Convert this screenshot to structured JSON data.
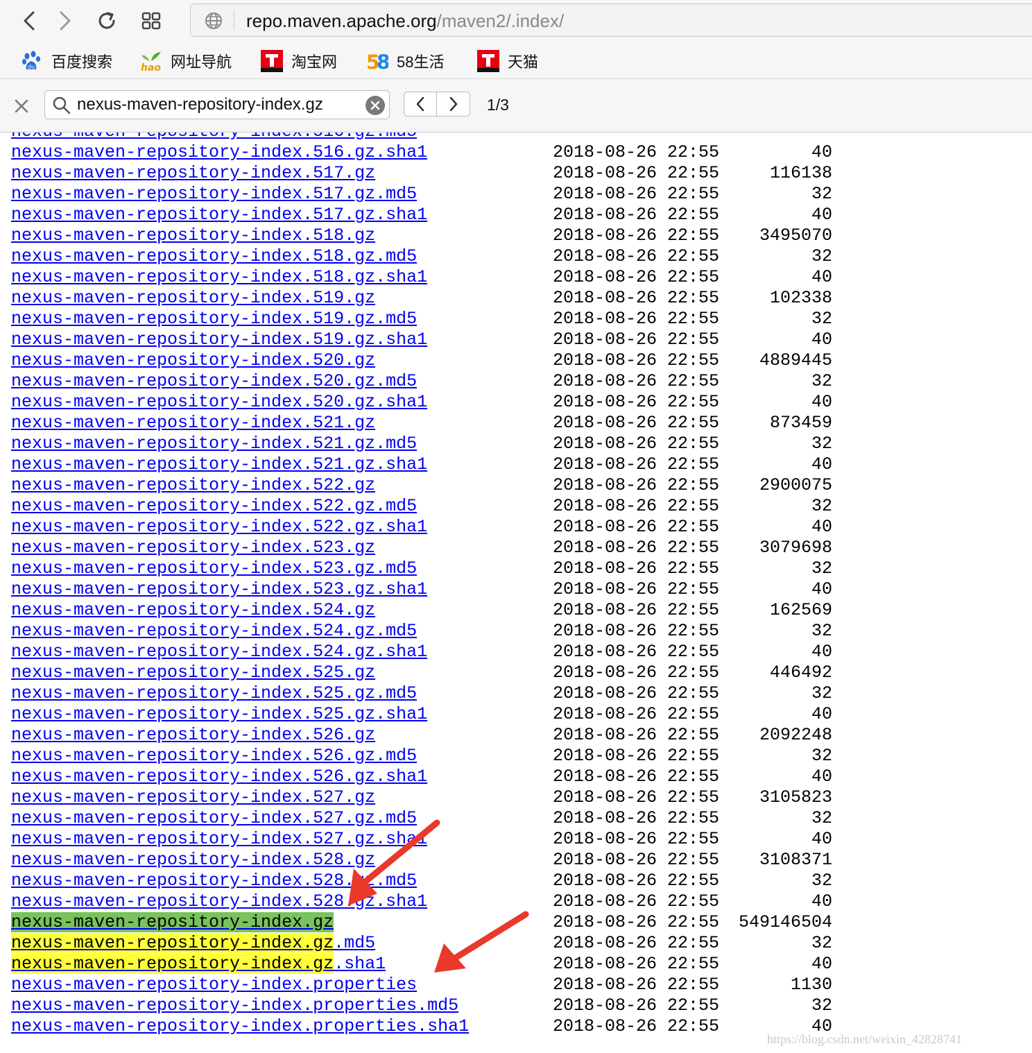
{
  "browser": {
    "url_host": "repo.maven.apache.org",
    "url_path": "/maven2/.index/",
    "icons": {
      "back": "chevron-left-icon",
      "forward": "chevron-right-icon",
      "reload": "reload-icon",
      "tabs": "grid-icon",
      "site": "globe-icon"
    }
  },
  "bookmarks": [
    {
      "label": "百度搜索",
      "icon": "baidu-paw-icon"
    },
    {
      "label": "网址导航",
      "icon": "hao-icon"
    },
    {
      "label": "淘宝网",
      "icon": "taobao-t-icon"
    },
    {
      "label": "58生活",
      "icon": "58-icon"
    },
    {
      "label": "天猫",
      "icon": "tmall-t-icon"
    }
  ],
  "findbar": {
    "query": "nexus-maven-repository-index.gz",
    "count": "1/3"
  },
  "listing": [
    {
      "name": "nexus-maven-repository-index.516.gz.sha1",
      "date": "2018-08-26 22:55",
      "size": "40"
    },
    {
      "name": "nexus-maven-repository-index.517.gz",
      "date": "2018-08-26 22:55",
      "size": "116138"
    },
    {
      "name": "nexus-maven-repository-index.517.gz.md5",
      "date": "2018-08-26 22:55",
      "size": "32"
    },
    {
      "name": "nexus-maven-repository-index.517.gz.sha1",
      "date": "2018-08-26 22:55",
      "size": "40"
    },
    {
      "name": "nexus-maven-repository-index.518.gz",
      "date": "2018-08-26 22:55",
      "size": "3495070"
    },
    {
      "name": "nexus-maven-repository-index.518.gz.md5",
      "date": "2018-08-26 22:55",
      "size": "32"
    },
    {
      "name": "nexus-maven-repository-index.518.gz.sha1",
      "date": "2018-08-26 22:55",
      "size": "40"
    },
    {
      "name": "nexus-maven-repository-index.519.gz",
      "date": "2018-08-26 22:55",
      "size": "102338"
    },
    {
      "name": "nexus-maven-repository-index.519.gz.md5",
      "date": "2018-08-26 22:55",
      "size": "32"
    },
    {
      "name": "nexus-maven-repository-index.519.gz.sha1",
      "date": "2018-08-26 22:55",
      "size": "40"
    },
    {
      "name": "nexus-maven-repository-index.520.gz",
      "date": "2018-08-26 22:55",
      "size": "4889445"
    },
    {
      "name": "nexus-maven-repository-index.520.gz.md5",
      "date": "2018-08-26 22:55",
      "size": "32"
    },
    {
      "name": "nexus-maven-repository-index.520.gz.sha1",
      "date": "2018-08-26 22:55",
      "size": "40"
    },
    {
      "name": "nexus-maven-repository-index.521.gz",
      "date": "2018-08-26 22:55",
      "size": "873459"
    },
    {
      "name": "nexus-maven-repository-index.521.gz.md5",
      "date": "2018-08-26 22:55",
      "size": "32"
    },
    {
      "name": "nexus-maven-repository-index.521.gz.sha1",
      "date": "2018-08-26 22:55",
      "size": "40"
    },
    {
      "name": "nexus-maven-repository-index.522.gz",
      "date": "2018-08-26 22:55",
      "size": "2900075"
    },
    {
      "name": "nexus-maven-repository-index.522.gz.md5",
      "date": "2018-08-26 22:55",
      "size": "32"
    },
    {
      "name": "nexus-maven-repository-index.522.gz.sha1",
      "date": "2018-08-26 22:55",
      "size": "40"
    },
    {
      "name": "nexus-maven-repository-index.523.gz",
      "date": "2018-08-26 22:55",
      "size": "3079698"
    },
    {
      "name": "nexus-maven-repository-index.523.gz.md5",
      "date": "2018-08-26 22:55",
      "size": "32"
    },
    {
      "name": "nexus-maven-repository-index.523.gz.sha1",
      "date": "2018-08-26 22:55",
      "size": "40"
    },
    {
      "name": "nexus-maven-repository-index.524.gz",
      "date": "2018-08-26 22:55",
      "size": "162569"
    },
    {
      "name": "nexus-maven-repository-index.524.gz.md5",
      "date": "2018-08-26 22:55",
      "size": "32"
    },
    {
      "name": "nexus-maven-repository-index.524.gz.sha1",
      "date": "2018-08-26 22:55",
      "size": "40"
    },
    {
      "name": "nexus-maven-repository-index.525.gz",
      "date": "2018-08-26 22:55",
      "size": "446492"
    },
    {
      "name": "nexus-maven-repository-index.525.gz.md5",
      "date": "2018-08-26 22:55",
      "size": "32"
    },
    {
      "name": "nexus-maven-repository-index.525.gz.sha1",
      "date": "2018-08-26 22:55",
      "size": "40"
    },
    {
      "name": "nexus-maven-repository-index.526.gz",
      "date": "2018-08-26 22:55",
      "size": "2092248"
    },
    {
      "name": "nexus-maven-repository-index.526.gz.md5",
      "date": "2018-08-26 22:55",
      "size": "32"
    },
    {
      "name": "nexus-maven-repository-index.526.gz.sha1",
      "date": "2018-08-26 22:55",
      "size": "40"
    },
    {
      "name": "nexus-maven-repository-index.527.gz",
      "date": "2018-08-26 22:55",
      "size": "3105823"
    },
    {
      "name": "nexus-maven-repository-index.527.gz.md5",
      "date": "2018-08-26 22:55",
      "size": "32"
    },
    {
      "name": "nexus-maven-repository-index.527.gz.sha1",
      "date": "2018-08-26 22:55",
      "size": "40"
    },
    {
      "name": "nexus-maven-repository-index.528.gz",
      "date": "2018-08-26 22:55",
      "size": "3108371"
    },
    {
      "name": "nexus-maven-repository-index.528.gz.md5",
      "date": "2018-08-26 22:55",
      "size": "32"
    },
    {
      "name": "nexus-maven-repository-index.528.gz.sha1",
      "date": "2018-08-26 22:55",
      "size": "40"
    },
    {
      "name": "nexus-maven-repository-index.gz",
      "date": "2018-08-26 22:55",
      "size": "549146504",
      "highlight": "current"
    },
    {
      "name": "nexus-maven-repository-index.gz.md5",
      "date": "2018-08-26 22:55",
      "size": "32",
      "highlight": "match"
    },
    {
      "name": "nexus-maven-repository-index.gz.sha1",
      "date": "2018-08-26 22:55",
      "size": "40",
      "highlight": "match"
    },
    {
      "name": "nexus-maven-repository-index.properties",
      "date": "2018-08-26 22:55",
      "size": "1130"
    },
    {
      "name": "nexus-maven-repository-index.properties.md5",
      "date": "2018-08-26 22:55",
      "size": "32"
    },
    {
      "name": "nexus-maven-repository-index.properties.sha1",
      "date": "2018-08-26 22:55",
      "size": "40"
    }
  ],
  "colors": {
    "link": "#0000ee",
    "find_current": "#78c35c",
    "find_match": "#ffff3c",
    "arrow": "#e8392b"
  },
  "watermark": "https://blog.csdn.net/weixin_42828741"
}
